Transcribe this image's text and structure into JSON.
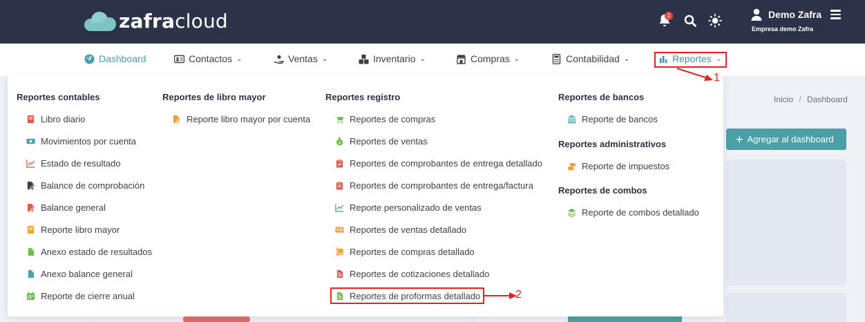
{
  "header": {
    "logo_bold": "zafra",
    "logo_light": "cloud",
    "notification_count": "1",
    "user_name": "Demo Zafra",
    "company": "Empresa demo Zafra"
  },
  "nav": {
    "items": [
      {
        "label": "Dashboard",
        "icon": "dashboard-icon",
        "active": true
      },
      {
        "label": "Contactos",
        "icon": "contacts-card-icon"
      },
      {
        "label": "Ventas",
        "icon": "sales-hand-icon"
      },
      {
        "label": "Inventario",
        "icon": "boxes-icon"
      },
      {
        "label": "Compras",
        "icon": "store-icon"
      },
      {
        "label": "Contabilidad",
        "icon": "calculator-icon"
      },
      {
        "label": "Reportes",
        "icon": "bar-chart-icon",
        "highlighted": true
      }
    ]
  },
  "breadcrumb": {
    "home": "Inicio",
    "sep": "/",
    "current": "Dashboard"
  },
  "add_dashboard_label": "Agregar al dashboard",
  "menu": {
    "contables": {
      "title": "Reportes contables",
      "items": [
        {
          "label": "Libro diario",
          "icon": "book-icon",
          "color": "#e05a4e"
        },
        {
          "label": "Movimientos por cuenta",
          "icon": "money-icon",
          "color": "#4aa3a3"
        },
        {
          "label": "Estado de resultado",
          "icon": "line-chart-icon",
          "color": "#e05a4e"
        },
        {
          "label": "Balance de comprobación",
          "icon": "file-sign-icon",
          "color": "#3b3f4a"
        },
        {
          "label": "Balance general",
          "icon": "file-sign-icon",
          "color": "#e05a4e"
        },
        {
          "label": "Reporte libro mayor",
          "icon": "book-icon",
          "color": "#f0a23a"
        },
        {
          "label": "Anexo estado de resultados",
          "icon": "file-icon",
          "color": "#6cc04a"
        },
        {
          "label": "Anexo balance general",
          "icon": "file-icon",
          "color": "#4aa3a3"
        },
        {
          "label": "Reporte de cierre anual",
          "icon": "calendar-icon",
          "color": "#6cc04a"
        }
      ]
    },
    "libro_mayor": {
      "title": "Reportes de libro mayor",
      "items": [
        {
          "label": "Reporte libro mayor por cuenta",
          "icon": "file-edit-icon",
          "color": "#f0a23a"
        }
      ]
    },
    "registro": {
      "title": "Reportes registro",
      "items": [
        {
          "label": "Reportes de compras",
          "icon": "cart-icon",
          "color": "#6cc04a"
        },
        {
          "label": "Reportes de ventas",
          "icon": "money-bag-icon",
          "color": "#6cc04a"
        },
        {
          "label": "Reportes de comprobantes de entrega detallado",
          "icon": "clipboard-check-icon",
          "color": "#e05a4e"
        },
        {
          "label": "Reportes de comprobantes de entrega/factura",
          "icon": "clipboard-icon",
          "color": "#e05a4e"
        },
        {
          "label": "Reporte personalizado de ventas",
          "icon": "line-chart-icon",
          "color": "#4aa3a3"
        },
        {
          "label": "Reportes de ventas detallado",
          "icon": "id-card-icon",
          "color": "#f0a23a"
        },
        {
          "label": "Reportes de compras detallado",
          "icon": "dolly-icon",
          "color": "#f0a23a"
        },
        {
          "label": "Reportes de cotizaciones detallado",
          "icon": "file-invoice-icon",
          "color": "#e05a4e"
        },
        {
          "label": "Reportes de proformas detallado",
          "icon": "file-invoice-icon",
          "color": "#6cc04a",
          "highlighted": true
        }
      ]
    },
    "bancos": {
      "title": "Reportes de bancos",
      "items": [
        {
          "label": "Reporte de bancos",
          "icon": "bank-icon",
          "color": "#4aa3a3"
        }
      ]
    },
    "administrativos": {
      "title": "Reportes administrativos",
      "items": [
        {
          "label": "Reporte de impuestos",
          "icon": "coins-icon",
          "color": "#f0a23a"
        }
      ]
    },
    "combos": {
      "title": "Reportes de combos",
      "items": [
        {
          "label": "Reporte de combos detallado",
          "icon": "layers-icon",
          "color": "#6cc04a"
        }
      ]
    }
  },
  "annotations": {
    "step1": "1",
    "step2": "2",
    "color": "#e8201d"
  }
}
